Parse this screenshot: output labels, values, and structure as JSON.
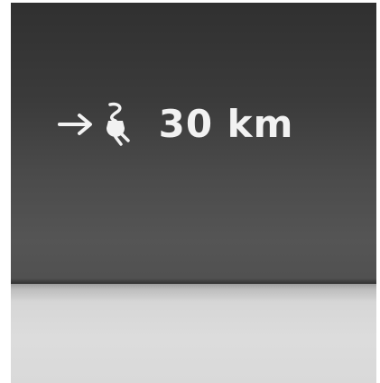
{
  "display": {
    "range_text": "30 km",
    "icons": {
      "arrow": "right-arrow-icon",
      "plug": "charging-plug-icon"
    },
    "colors": {
      "screen_top": "#303030",
      "screen_bottom": "#555555",
      "text": "#f2f2f2",
      "bezel": "#d8d8d8"
    }
  }
}
